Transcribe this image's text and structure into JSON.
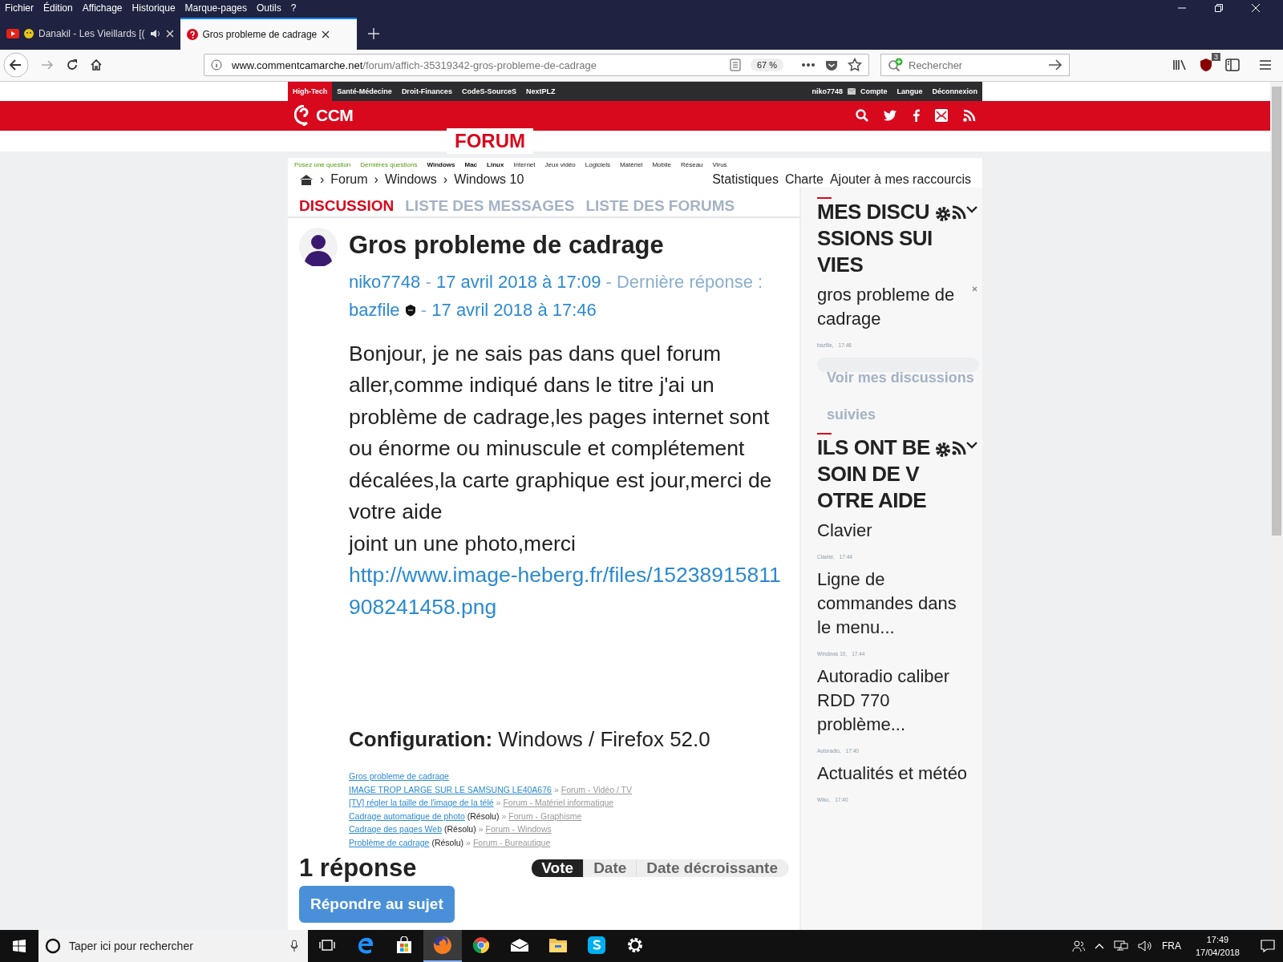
{
  "menu_bar": [
    {
      "label": "Fichier"
    },
    {
      "label": "Édition"
    },
    {
      "label": "Affichage"
    },
    {
      "label": "Historique"
    },
    {
      "label": "Marque-pages"
    },
    {
      "label": "Outils"
    },
    {
      "label": "?"
    }
  ],
  "tabs": [
    {
      "title": "Danakil - Les Vieillards [(",
      "selected": false,
      "kind": "video"
    },
    {
      "title": "Gros probleme de cadrage",
      "selected": true,
      "kind": "site"
    }
  ],
  "address_bar": {
    "domain": "www.commentcamarche.net",
    "path": "/forum/affich-35319342-gros-probleme-de-cadrage",
    "zoom": "67 %"
  },
  "search": {
    "placeholder": "Rechercher"
  },
  "addon_badge": "3",
  "site": {
    "top_nav": [
      {
        "label": "High-Tech",
        "selected": true
      },
      {
        "label": "Santé-Médecine",
        "selected": false
      },
      {
        "label": "Droit-Finances",
        "selected": false
      },
      {
        "label": "CodeS-SourceS",
        "selected": false
      },
      {
        "label": "NextPLZ",
        "selected": false
      }
    ],
    "user": "niko7748",
    "user_links": [
      "Compte",
      "Langue",
      "Déconnexion"
    ],
    "logo": "CCM",
    "section": "FORUM",
    "sub_nav": [
      {
        "label": "Posez une question",
        "kind": "action"
      },
      {
        "label": "Dernières questions",
        "kind": "action"
      },
      {
        "label": "Windows",
        "kind": "bold"
      },
      {
        "label": "Mac",
        "kind": "bold"
      },
      {
        "label": "Linux",
        "kind": "bold"
      },
      {
        "label": "Internet",
        "kind": "plain"
      },
      {
        "label": "Jeux vidéo",
        "kind": "plain"
      },
      {
        "label": "Logiciels",
        "kind": "plain"
      },
      {
        "label": "Matériel",
        "kind": "plain"
      },
      {
        "label": "Mobile",
        "kind": "plain"
      },
      {
        "label": "Réseau",
        "kind": "plain"
      },
      {
        "label": "Virus",
        "kind": "plain"
      }
    ],
    "breadcrumb_separator": "›",
    "breadcrumb": [
      "Forum",
      "Windows",
      "Windows 10"
    ],
    "page_links": [
      "Statistiques",
      "Charte",
      "Ajouter à mes raccourcis"
    ]
  },
  "thread_tabs": [
    {
      "label": "DISCUSSION",
      "selected": true
    },
    {
      "label": "LISTE DES MESSAGES",
      "selected": false
    },
    {
      "label": "LISTE DES FORUMS",
      "selected": false
    }
  ],
  "post": {
    "title": "Gros probleme de cadrage",
    "author": "niko7748",
    "separator": "-",
    "date": "17 avril 2018 à 17:09",
    "last_reply_label": "- Dernière réponse :",
    "last_author": "bazfile",
    "last_date": "17 avril 2018 à 17:46",
    "body": [
      "Bonjour, je ne sais pas dans quel forum aller,comme indiqué dans le titre j'ai un problème de cadrage,les pages internet sont ou énorme ou minuscule et complétement décalées,la carte graphique est jour,merci de votre aide",
      "joint un une photo,merci"
    ],
    "link": "http://www.image-heberg.fr/files/15238915811908241458.png",
    "configuration_label": "Configuration:",
    "configuration": "Windows / Firefox 52.0"
  },
  "related": [
    {
      "title": "Gros probleme de cadrage"
    },
    {
      "title": "IMAGE TROP LARGE SUR LE SAMSUNG LE40A676",
      "separator": "»",
      "forum": "Forum - Vidéo / TV"
    },
    {
      "title": "[TV] régler la taille de l'image de la télé",
      "separator": "»",
      "forum": "Forum - Matériel informatique"
    },
    {
      "title": "Cadrage automatique de photo",
      "status": "(Résolu)",
      "separator": "»",
      "forum": "Forum - Graphisme"
    },
    {
      "title": "Cadrage des pages Web",
      "status": "(Résolu)",
      "separator": "»",
      "forum": "Forum - Windows"
    },
    {
      "title": "Problème de cadrage",
      "status": "(Résolu)",
      "separator": "»",
      "forum": "Forum - Bureautique"
    }
  ],
  "replies": {
    "count": "1 réponse",
    "sort": [
      {
        "label": "Vote",
        "selected": true
      },
      {
        "label": "Date",
        "selected": false
      },
      {
        "label": "Date décroissante",
        "selected": false
      }
    ],
    "reply_button": "Répondre au sujet"
  },
  "sidebar": {
    "followed": {
      "title": "MES DISCUSSIONS SUIVIES",
      "items": [
        {
          "title": "gros probleme de cadrage",
          "meta": "bazfile,",
          "time": "17:46"
        }
      ],
      "more": "Voir mes discussions suivies"
    },
    "help": {
      "title": "ILS ONT BESOIN DE VOTRE AIDE",
      "items": [
        {
          "title": "Clavier",
          "meta": "Clavier,",
          "time": "17:44"
        },
        {
          "title": "Ligne de commandes dans le menu...",
          "meta": "Windows 10,",
          "time": "17:44"
        },
        {
          "title": "Autoradio caliber RDD 770 problème...",
          "meta": "Autoradio,",
          "time": "17:40"
        },
        {
          "title": "Actualités et météo",
          "meta": "Wiko,",
          "time": "17:40"
        }
      ]
    }
  },
  "taskbar": {
    "search_placeholder": "Taper ici pour rechercher",
    "apps": [
      {
        "kind": "taskview",
        "selected": false
      },
      {
        "kind": "edge",
        "selected": false
      },
      {
        "kind": "store",
        "selected": false
      },
      {
        "kind": "firefox",
        "selected": true
      },
      {
        "kind": "chrome",
        "selected": false
      },
      {
        "kind": "mail",
        "selected": false
      },
      {
        "kind": "explorer",
        "selected": false
      },
      {
        "kind": "skype",
        "selected": false
      },
      {
        "kind": "settings",
        "selected": false
      }
    ],
    "language": "FRA",
    "time": "17:49",
    "date": "17/04/2018"
  }
}
